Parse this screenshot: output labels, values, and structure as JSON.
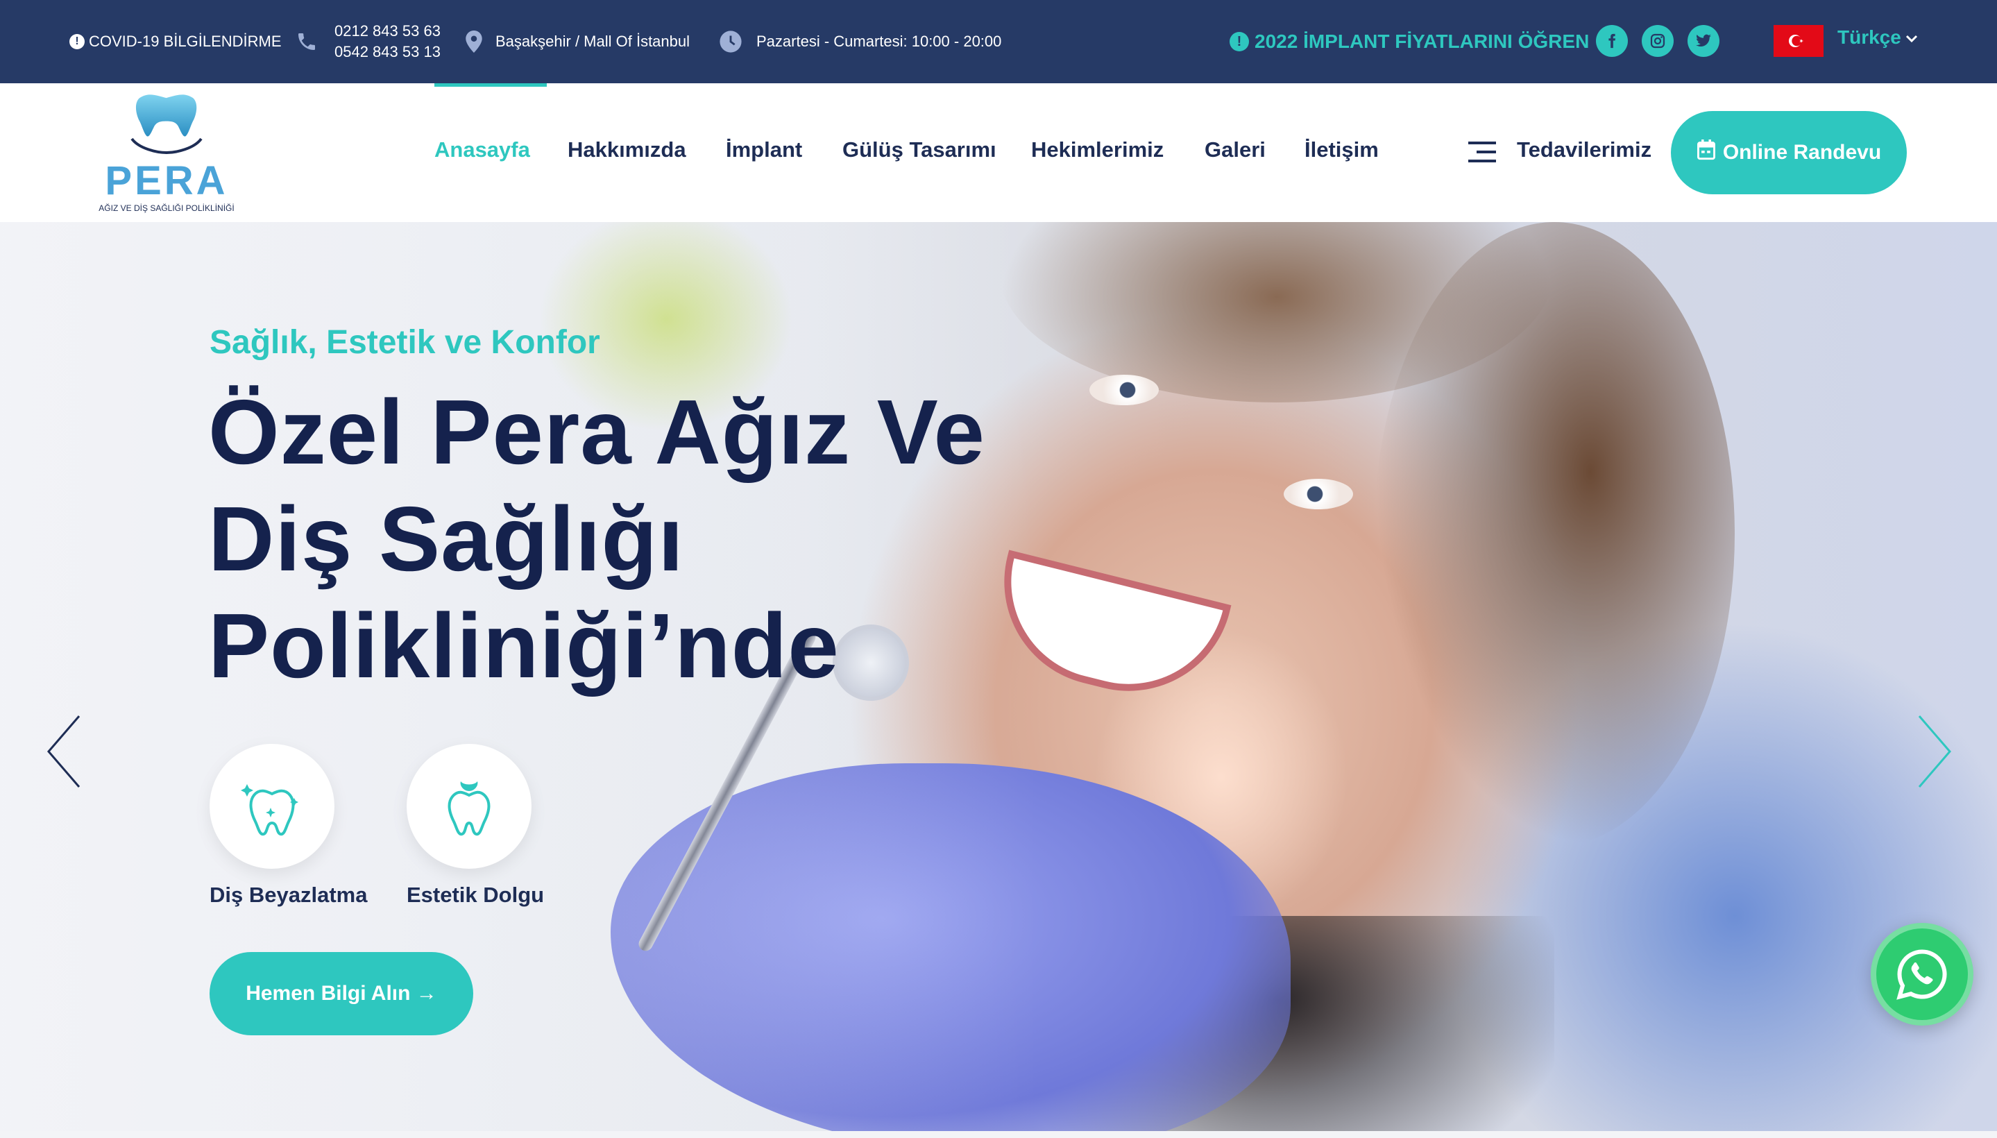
{
  "topbar": {
    "covid": "COVID-19 BİLGİLENDİRME",
    "phone1": "0212 843 53 63",
    "phone2": "0542 843 53 13",
    "location": "Başakşehir / Mall Of İstanbul",
    "hours": "Pazartesi - Cumartesi: 10:00 - 20:00",
    "implant_link": "2022 İMPLANT FİYATLARINI ÖĞREN",
    "social": [
      "facebook-icon",
      "instagram-icon",
      "twitter-icon"
    ],
    "language": "Türkçe"
  },
  "logo": {
    "name": "PERA",
    "tagline": "AĞIZ VE DİŞ SAĞLIĞI POLİKLİNİĞİ"
  },
  "nav": {
    "items": [
      "Anasayfa",
      "Hakkımızda",
      "İmplant",
      "Gülüş Tasarımı",
      "Hekimlerimiz",
      "Galeri",
      "İletişim"
    ],
    "active": "Anasayfa",
    "treatments": "Tedavilerimiz",
    "cta": "Online Randevu"
  },
  "hero": {
    "kicker": "Sağlık, Estetik ve Konfor",
    "headline": "Özel Pera Ağız Ve Diş Sağlığı Polikliniği’nde",
    "features": [
      "Diş Beyazlatma",
      "Estetik Dolgu"
    ],
    "button": "Hemen Bilgi Alın →"
  },
  "colors": {
    "accent": "#2ec7bf",
    "topbar": "#263a66",
    "navy": "#15224d",
    "whatsapp": "#2ecc71"
  }
}
